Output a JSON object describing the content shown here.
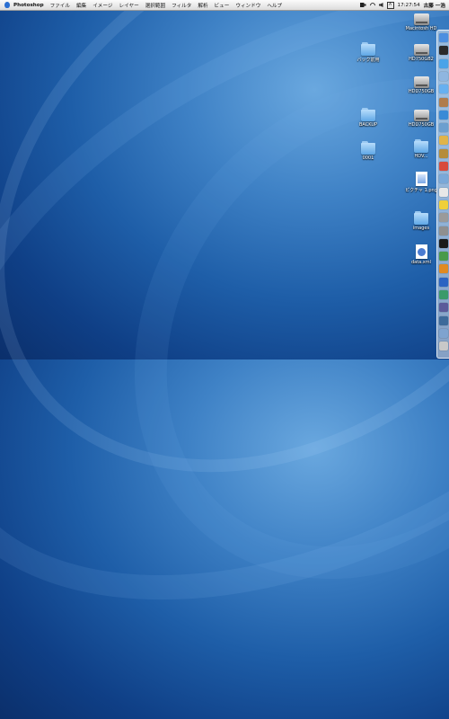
{
  "menubar": {
    "app_name": "Photoshop",
    "menus": [
      "ファイル",
      "編集",
      "イメージ",
      "レイヤー",
      "選択範囲",
      "フィルタ",
      "解析",
      "ビュー",
      "ウィンドウ",
      "ヘルプ"
    ],
    "clock": "17:27:54",
    "user": "古藤 一浩",
    "input_lang": "A"
  },
  "desktop_icons": {
    "macintosh_hd": "Macintosh HD",
    "hd750gb2": "HD750GB2",
    "hdd750gb_a": "HDD750GB",
    "hdd750gb_b": "HDD750GB",
    "tmp_folder": "バック前用",
    "backup": "BACKUP",
    "folder_0001": "0001",
    "hdv": "HDV...",
    "picture": "ピクチャ 1.png",
    "images": "images",
    "data_xml": "data.xml"
  },
  "dock": {
    "items": [
      {
        "name": "finder-icon",
        "color": "#4d8fe0"
      },
      {
        "name": "dashboard-icon",
        "color": "#2a2a2a"
      },
      {
        "name": "safari-icon",
        "color": "#4aa3e8"
      },
      {
        "name": "mail-icon",
        "color": "#8fb6e0"
      },
      {
        "name": "ichat-icon",
        "color": "#67b0f0"
      },
      {
        "name": "address-book-icon",
        "color": "#b07c4c"
      },
      {
        "name": "itunes-icon",
        "color": "#3a8ad6"
      },
      {
        "name": "iphoto-icon",
        "color": "#6c9fcf"
      },
      {
        "name": "imovie-icon",
        "color": "#e0b44a"
      },
      {
        "name": "idvd-icon",
        "color": "#b58c3a"
      },
      {
        "name": "ical-icon",
        "color": "#d84b3b"
      },
      {
        "name": "preview-icon",
        "color": "#7aa8d8"
      },
      {
        "name": "text-edit-icon",
        "color": "#e8e8e8"
      },
      {
        "name": "stickies-icon",
        "color": "#f0cf3a"
      },
      {
        "name": "script-icon",
        "color": "#9a9a9a"
      },
      {
        "name": "system-prefs-icon",
        "color": "#8f8f8f"
      },
      {
        "name": "terminal-icon",
        "color": "#1a1a1a"
      },
      {
        "name": "activity-monitor-icon",
        "color": "#4a9a4a"
      },
      {
        "name": "illustrator-icon",
        "color": "#e08a22"
      },
      {
        "name": "photoshop-icon",
        "color": "#2b63c2"
      },
      {
        "name": "dreamweaver-icon",
        "color": "#3a9a6a"
      },
      {
        "name": "bridge-icon",
        "color": "#5b5b9a"
      },
      {
        "name": "lightroom-icon",
        "color": "#3d6a9a"
      },
      {
        "name": "app-icon",
        "color": "#7fa3cf"
      },
      {
        "name": "trash-icon",
        "color": "#c8c8c8"
      }
    ]
  }
}
